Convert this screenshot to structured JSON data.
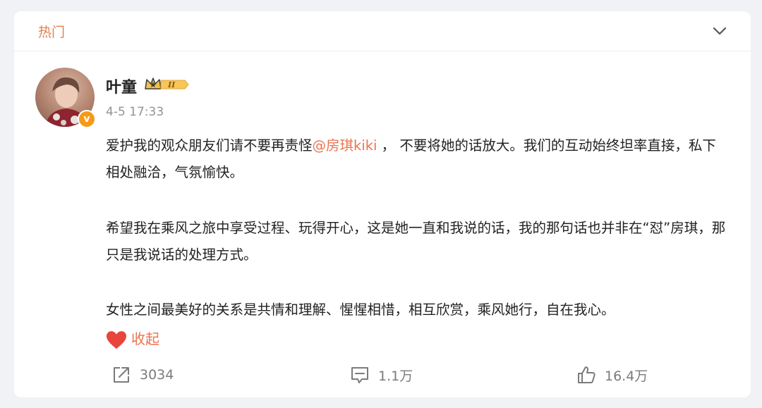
{
  "header": {
    "tab_label": "热门"
  },
  "post": {
    "author_name": "叶童",
    "member_level": "II",
    "timestamp": "4-5 17:33",
    "para1_a": "爱护我的观众朋友们请不要再责怪",
    "mention": "@房琪kiki",
    "para1_b": " ， 不要将她的话放大。我们的互动始终坦率直接，私下相处融洽，气氛愉快。",
    "para2": "希望我在乘风之旅中享受过程、玩得开心，这是她一直和我说的话，我的那句话也并非在“怼”房琪，那只是我说话的处理方式。",
    "para3": "女性之间最美好的关系是共情和理解、惺惺相惜，相互欣赏，乘风她行，自在我心。",
    "collapse_label": "收起"
  },
  "actions": {
    "repost_count": "3034",
    "comment_count": "1.1万",
    "like_count": "16.4万"
  },
  "colors": {
    "accent": "#eb7350",
    "verified": "#f59a18",
    "secondary_text": "#939393"
  }
}
